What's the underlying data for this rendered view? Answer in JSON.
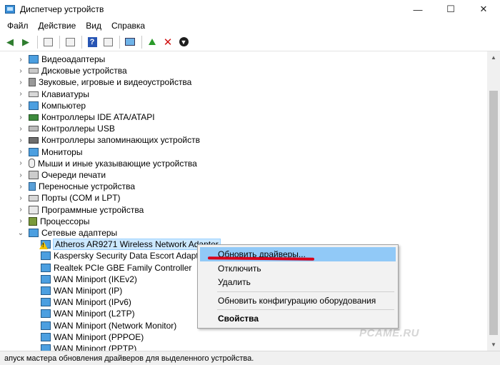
{
  "window": {
    "title": "Диспетчер устройств",
    "minimize": "—",
    "maximize": "☐",
    "close": "✕"
  },
  "menu": [
    "Файл",
    "Действие",
    "Вид",
    "Справка"
  ],
  "toolbar": {
    "help_label": "?"
  },
  "tree": [
    {
      "label": "Видеоадаптеры",
      "icon": "display-adapter-icon",
      "cls": "monitor"
    },
    {
      "label": "Дисковые устройства",
      "icon": "disk-drive-icon",
      "cls": "disk"
    },
    {
      "label": "Звуковые, игровые и видеоустройства",
      "icon": "speaker-icon",
      "cls": "sound"
    },
    {
      "label": "Клавиатуры",
      "icon": "keyboard-icon",
      "cls": "kbd"
    },
    {
      "label": "Компьютер",
      "icon": "computer-icon",
      "cls": "pc"
    },
    {
      "label": "Контроллеры IDE ATA/ATAPI",
      "icon": "ide-controller-icon",
      "cls": "ide"
    },
    {
      "label": "Контроллеры USB",
      "icon": "usb-controller-icon",
      "cls": "usb"
    },
    {
      "label": "Контроллеры запоминающих устройств",
      "icon": "storage-controller-icon",
      "cls": "storage"
    },
    {
      "label": "Мониторы",
      "icon": "monitor-icon",
      "cls": "monitor"
    },
    {
      "label": "Мыши и иные указывающие устройства",
      "icon": "mouse-icon",
      "cls": "mouse"
    },
    {
      "label": "Очереди печати",
      "icon": "printer-icon",
      "cls": "printer"
    },
    {
      "label": "Переносные устройства",
      "icon": "portable-device-icon",
      "cls": "portable"
    },
    {
      "label": "Порты (COM и LPT)",
      "icon": "port-icon",
      "cls": "port"
    },
    {
      "label": "Программные устройства",
      "icon": "software-device-icon",
      "cls": "software"
    },
    {
      "label": "Процессоры",
      "icon": "processor-icon",
      "cls": "cpu"
    },
    {
      "label": "Сетевые адаптеры",
      "icon": "network-adapter-icon",
      "cls": "net",
      "expanded": true
    }
  ],
  "network_adapters": [
    {
      "label": "Atheros AR9271 Wireless Network Adapter",
      "warning": true,
      "selected": true
    },
    {
      "label": "Kaspersky Security Data Escort Adapter"
    },
    {
      "label": "Realtek PCIe GBE Family Controller"
    },
    {
      "label": "WAN Miniport (IKEv2)"
    },
    {
      "label": "WAN Miniport (IP)"
    },
    {
      "label": "WAN Miniport (IPv6)"
    },
    {
      "label": "WAN Miniport (L2TP)"
    },
    {
      "label": "WAN Miniport (Network Monitor)"
    },
    {
      "label": "WAN Miniport (PPPOE)"
    },
    {
      "label": "WAN Miniport (PPTP)"
    }
  ],
  "context_menu": {
    "update_drivers": "Обновить драйверы...",
    "disable": "Отключить",
    "uninstall": "Удалить",
    "scan_hardware": "Обновить конфигурацию оборудования",
    "properties": "Свойства"
  },
  "status_text": "апуск мастера обновления драйверов для выделенного устройства.",
  "watermark": "PCAME.RU",
  "colors": {
    "highlight": "#91c9f7",
    "selection": "#cce8ff",
    "annotation": "#d9001b"
  }
}
